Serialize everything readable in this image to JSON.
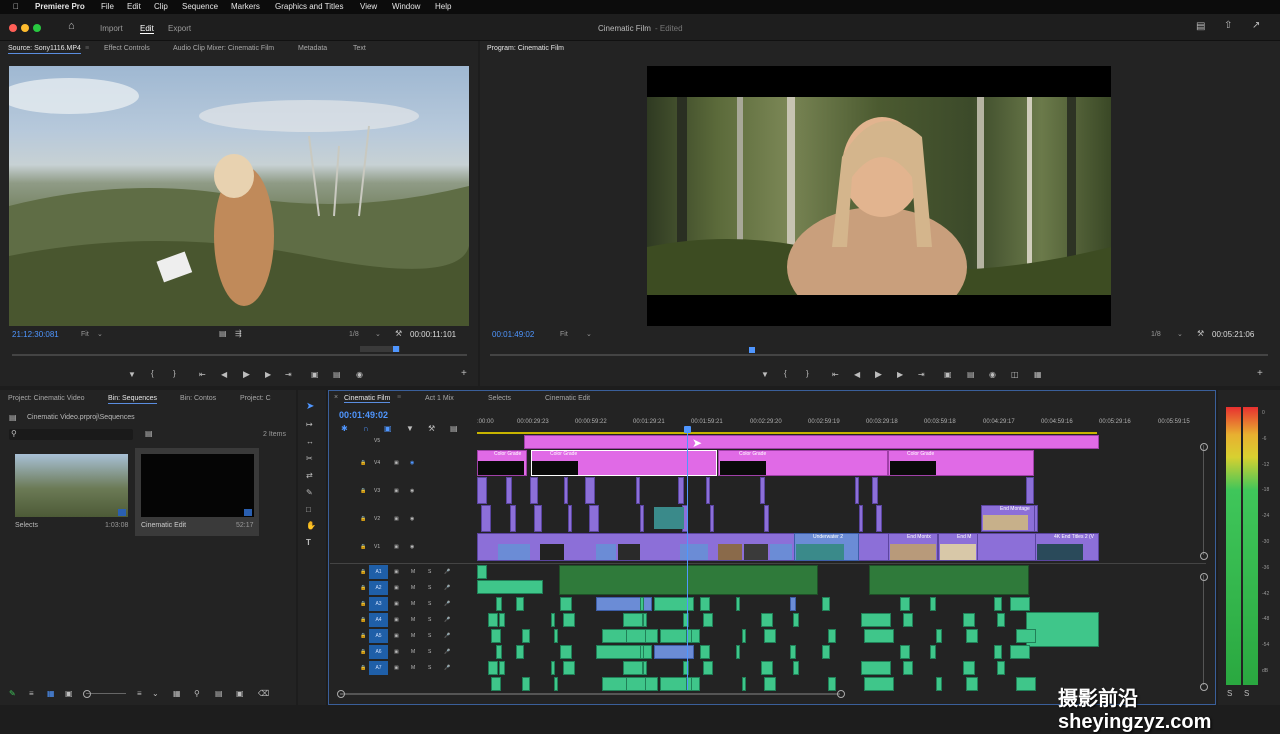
{
  "menubar": {
    "app": "Premiere Pro",
    "items": [
      "File",
      "Edit",
      "Clip",
      "Sequence",
      "Markers",
      "Graphics and Titles",
      "View",
      "Window",
      "Help"
    ]
  },
  "titlebar": {
    "workspaces": [
      "Import",
      "Edit",
      "Export"
    ],
    "active_workspace": "Edit",
    "title": "Cinematic Film",
    "edited": "- Edited"
  },
  "source": {
    "tabs": [
      "Source: Sony1116.MP4",
      "Effect Controls",
      "Audio Clip Mixer: Cinematic Film",
      "Metadata",
      "Text"
    ],
    "timecode": "21:12:30:081",
    "fit": "Fit",
    "resolution": "1/8",
    "duration": "00:00:11:101"
  },
  "program": {
    "tab": "Program: Cinematic Film",
    "timecode": "00:01:49:02",
    "fit": "Fit",
    "resolution": "1/8",
    "duration": "00:05:21:06"
  },
  "project": {
    "tabs": [
      "Project: Cinematic Video",
      "Bin: Sequences",
      "Bin: Contos",
      "Project: C"
    ],
    "path": "Cinematic Video.prproj\\Sequences",
    "items_count": "2 Items",
    "items": [
      {
        "name": "Selects",
        "duration": "1:03:08"
      },
      {
        "name": "Cinematic Edit",
        "duration": "52:17"
      }
    ]
  },
  "timeline": {
    "tabs": [
      "Cinematic Film",
      "Act 1 Mix",
      "Selects",
      "Cinematic Edit"
    ],
    "timecode": "00:01:49:02",
    "ruler": [
      ":00:00",
      "00:00:29:23",
      "00:00:59:22",
      "00:01:29:21",
      "00:01:59:21",
      "00:02:29:20",
      "00:02:59:19",
      "00:03:29:18",
      "00:03:59:18",
      "00:04:29:17",
      "00:04:59:16",
      "00:05:29:16",
      "00:05:59:15"
    ],
    "video_tracks": [
      "V5",
      "V4",
      "V3",
      "V2",
      "V1"
    ],
    "audio_tracks": [
      "A1",
      "A2",
      "A3",
      "A4",
      "A5",
      "A6",
      "A7"
    ],
    "audio_btns": [
      "M",
      "S"
    ],
    "clip_labels": {
      "color_grade": "Color Grade",
      "underwater": "Underwater 2",
      "end_montage": "End Montage",
      "end_montg": "End Montx",
      "end_m": "End M",
      "end_titles": "4K End Titles 2 (V"
    }
  },
  "meter": {
    "scale": [
      "0",
      "-6",
      "-12",
      "-18",
      "-24",
      "-30",
      "-36",
      "-42",
      "-48",
      "-54",
      "dB"
    ],
    "top": [
      "-6",
      "-6"
    ]
  },
  "watermark": "摄影前沿 sheyingzyz.com"
}
